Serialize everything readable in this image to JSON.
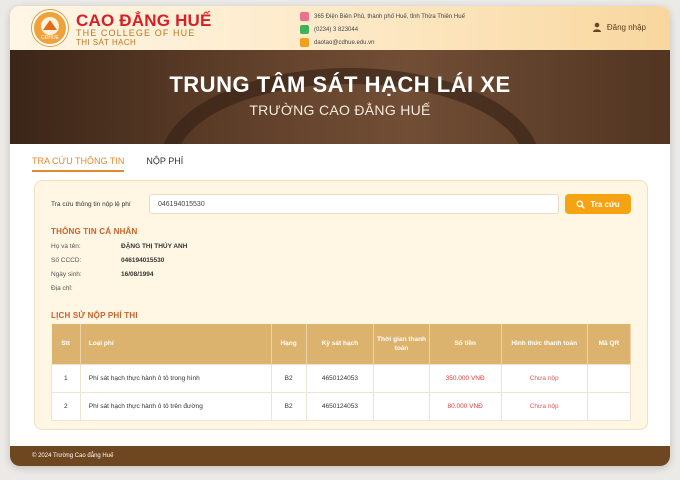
{
  "header": {
    "brand_main": "CAO ĐẲNG HUẾ",
    "brand_sub": "THE COLLEGE OF HUE",
    "brand_tag": "THI SÁT HẠCH",
    "logo_text": "CĐHUE",
    "contacts": [
      {
        "icon": "location-pin-icon",
        "color": "#e8738a",
        "text": "365 Điện Biên Phủ, thành phố Huế, tỉnh Thừa Thiên Huế"
      },
      {
        "icon": "phone-icon",
        "color": "#3cb55a",
        "text": "(0234) 3 823044"
      },
      {
        "icon": "mail-icon",
        "color": "#f0a01c",
        "text": "daotao@cdhue.edu.vn"
      }
    ],
    "login_label": "Đăng nhập"
  },
  "banner": {
    "title": "TRUNG TÂM SÁT HẠCH LÁI XE",
    "subtitle": "TRƯỜNG CAO ĐẲNG HUẾ"
  },
  "tabs": [
    {
      "label": "TRA CỨU THÔNG TIN",
      "active": true
    },
    {
      "label": "NỘP PHÍ",
      "active": false
    }
  ],
  "search": {
    "label": "Tra cứu thông tin nộp lệ phí",
    "value": "046194015530",
    "button_label": "Tra cứu"
  },
  "personal": {
    "title": "THÔNG TIN CÁ NHÂN",
    "rows": [
      {
        "label": "Họ và tên:",
        "value": "ĐẶNG THỊ THÚY ANH"
      },
      {
        "label": "Số CCCD:",
        "value": "046194015530"
      },
      {
        "label": "Ngày sinh:",
        "value": "16/08/1994"
      },
      {
        "label": "Địa chỉ:",
        "value": ""
      }
    ]
  },
  "history": {
    "title": "LỊCH SỬ NỘP PHÍ THI",
    "columns": [
      "Stt",
      "Loại phí",
      "Hạng",
      "Kỳ sát hạch",
      "Thời gian thanh toán",
      "Số tiền",
      "Hình thức thanh toán",
      "Mã QR"
    ],
    "rows": [
      [
        "1",
        "Phí sát hạch thực hành ô tô trong hình",
        "B2",
        "4650124053",
        "",
        "350.000 VNĐ",
        "Chưa nộp",
        ""
      ],
      [
        "2",
        "Phí sát hạch thực hành ô tô trên đường",
        "B2",
        "4650124053",
        "",
        "80.000 VNĐ",
        "Chưa nộp",
        ""
      ]
    ]
  },
  "footer": {
    "text": "© 2024 Trường Cao đẳng Huế"
  }
}
